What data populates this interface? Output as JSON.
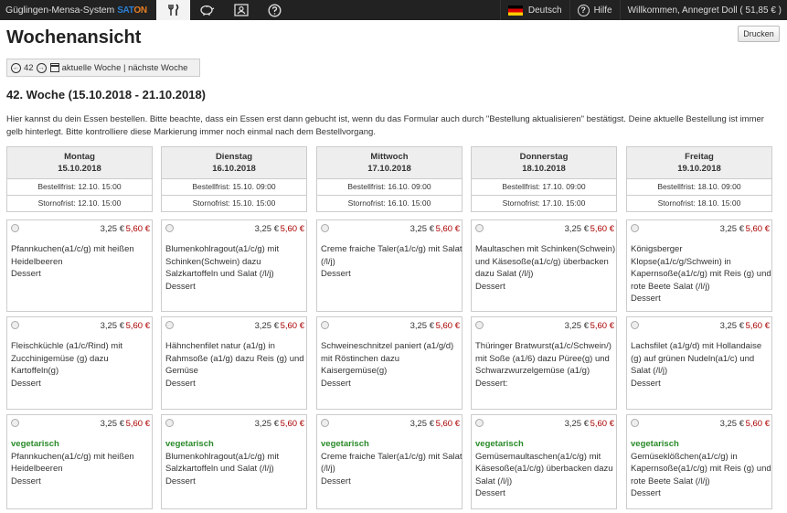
{
  "navbar": {
    "brand": "Güglingen-Mensa-System",
    "logo_a": "SAT",
    "logo_b": "ON",
    "language": "Deutsch",
    "help": "Hilfe",
    "welcome": "Willkommen, Annegret Doll ( 51,85 € )"
  },
  "page": {
    "title": "Wochenansicht",
    "print_label": "Drucken",
    "week_number": "42",
    "week_links": "aktuelle Woche | nächste Woche",
    "week_heading": "42. Woche (15.10.2018 - 21.10.2018)",
    "intro": "Hier kannst du dein Essen bestellen. Bitte beachte, dass ein Essen erst dann gebucht ist, wenn du das Formular auch durch \"Bestellung aktualisieren\" bestätigst. Deine aktuelle Bestellung ist immer gelb hinterlegt. Bitte kontrolliere diese Markierung immer noch einmal nach dem Bestellvorgang."
  },
  "days": [
    {
      "name": "Montag",
      "date": "15.10.2018",
      "order_deadline": "Bestellfrist: 12.10. 15:00",
      "cancel_deadline": "Stornofrist: 12.10. 15:00",
      "meals": [
        {
          "price1": "3,25 €",
          "price2": "5,60 €",
          "veg": "",
          "text": "Pfannkuchen(a1/c/g) mit heißen Heidelbeeren",
          "dessert": "Dessert"
        },
        {
          "price1": "3,25 €",
          "price2": "5,60 €",
          "veg": "",
          "text": "Fleischküchle (a1/c/Rind) mit Zucchinigemüse (g) dazu Kartoffeln(g)",
          "dessert": "Dessert"
        },
        {
          "price1": "3,25 €",
          "price2": "5,60 €",
          "veg": "vegetarisch",
          "text": "Pfannkuchen(a1/c/g) mit heißen Heidelbeeren",
          "dessert": "Dessert"
        }
      ]
    },
    {
      "name": "Dienstag",
      "date": "16.10.2018",
      "order_deadline": "Bestellfrist: 15.10. 09:00",
      "cancel_deadline": "Stornofrist: 15.10. 15:00",
      "meals": [
        {
          "price1": "3,25 €",
          "price2": "5,60 €",
          "veg": "",
          "text": "Blumenkohlragout(a1/c/g) mit Schinken(Schwein) dazu Salzkartoffeln und Salat (/l/j)",
          "dessert": "Dessert"
        },
        {
          "price1": "3,25 €",
          "price2": "5,60 €",
          "veg": "",
          "text": "Hähnchenfilet natur (a1/g) in Rahmsoße (a1/g) dazu Reis (g) und Gemüse",
          "dessert": "Dessert"
        },
        {
          "price1": "3,25 €",
          "price2": "5,60 €",
          "veg": "vegetarisch",
          "text": "Blumenkohlragout(a1/c/g) mit Salzkartoffeln und Salat (/l/j)",
          "dessert": "Dessert"
        }
      ]
    },
    {
      "name": "Mittwoch",
      "date": "17.10.2018",
      "order_deadline": "Bestellfrist: 16.10. 09:00",
      "cancel_deadline": "Stornofrist: 16.10. 15:00",
      "meals": [
        {
          "price1": "3,25 €",
          "price2": "5,60 €",
          "veg": "",
          "text": "Creme fraiche Taler(a1/c/g) mit Salat (/l/j)",
          "dessert": "Dessert"
        },
        {
          "price1": "3,25 €",
          "price2": "5,60 €",
          "veg": "",
          "text": "Schweineschnitzel paniert (a1/g/d) mit Röstinchen dazu Kaisergemüse(g)",
          "dessert": "Dessert"
        },
        {
          "price1": "3,25 €",
          "price2": "5,60 €",
          "veg": "vegetarisch",
          "text": "Creme fraiche Taler(a1/c/g) mit Salat (/l/j)",
          "dessert": "Dessert"
        }
      ]
    },
    {
      "name": "Donnerstag",
      "date": "18.10.2018",
      "order_deadline": "Bestellfrist: 17.10. 09:00",
      "cancel_deadline": "Stornofrist: 17.10. 15:00",
      "meals": [
        {
          "price1": "3,25 €",
          "price2": "5,60 €",
          "veg": "",
          "text": "Maultaschen mit Schinken(Schwein) und Käsesoße(a1/c/g) überbacken dazu Salat (/l/j)",
          "dessert": "Dessert"
        },
        {
          "price1": "3,25 €",
          "price2": "5,60 €",
          "veg": "",
          "text": "Thüringer Bratwurst(a1/c/Schwein/) mit Soße (a1/6) dazu Püree(g) und Schwarzwurzelgemüse (a1/g)",
          "dessert": "Dessert:"
        },
        {
          "price1": "3,25 €",
          "price2": "5,60 €",
          "veg": "vegetarisch",
          "text": "Gemüsemaultaschen(a1/c/g) mit Käsesoße(a1/c/g) überbacken dazu Salat (/l/j)",
          "dessert": "Dessert"
        }
      ]
    },
    {
      "name": "Freitag",
      "date": "19.10.2018",
      "order_deadline": "Bestellfrist: 18.10. 09:00",
      "cancel_deadline": "Stornofrist: 18.10. 15:00",
      "meals": [
        {
          "price1": "3,25 €",
          "price2": "5,60 €",
          "veg": "",
          "text": "Königsberger Klopse(a1/c/g/Schwein) in Kapernsoße(a1/c/g) mit Reis (g) und rote Beete Salat (/l/j)",
          "dessert": "Dessert"
        },
        {
          "price1": "3,25 €",
          "price2": "5,60 €",
          "veg": "",
          "text": "Lachsfilet (a1/g/d) mit Hollandaise (g) auf grünen Nudeln(a1/c) und Salat (/l/j)",
          "dessert": "Dessert"
        },
        {
          "price1": "3,25 €",
          "price2": "5,60 €",
          "veg": "vegetarisch",
          "text": "Gemüseklößchen(a1/c/g) in Kapernsoße(a1/c/g) mit Reis (g) und rote Beete Salat (/l/j)",
          "dessert": "Dessert"
        }
      ]
    }
  ]
}
